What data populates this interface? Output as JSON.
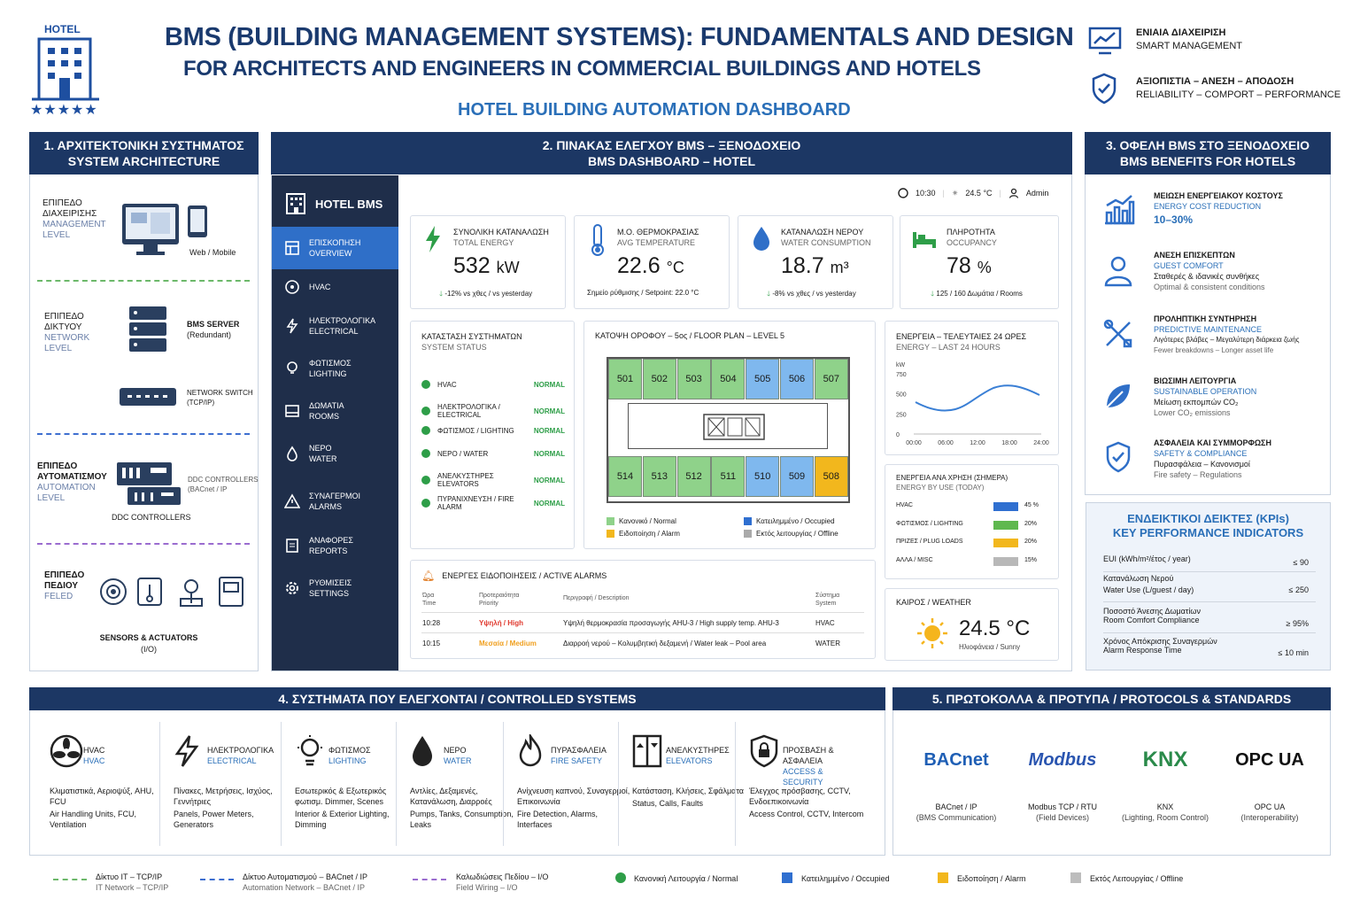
{
  "header": {
    "logo_text": "HOTEL",
    "logo_stars": "★★★★★",
    "title_line1": "BMS (BUILDING MANAGEMENT SYSTEMS): FUNDAMENTALS AND DESIGN",
    "title_line2": "FOR ARCHITECTS AND ENGINEERS IN COMMERCIAL BUILDINGS AND HOTELS",
    "subtitle": "HOTEL BUILDING AUTOMATION DASHBOARD",
    "badge1_gr": "ΕΝΙΑΙΑ ΔΙΑΧΕΙΡΙΣΗ",
    "badge1_en": "SMART MANAGEMENT",
    "badge2_gr": "ΑΞΙΟΠΙΣΤΙΑ – ΑΝΕΣΗ – ΑΠΟΔΟΣΗ",
    "badge2_en": "RELIABILITY – COMPORT – PERFORMANCE"
  },
  "section1": {
    "title_gr": "1. ΑΡΧΙΤΕΚΤΟΝΙΚΗ ΣΥΣΤΗΜΑΤΟΣ",
    "title_en": "SYSTEM ARCHITECTURE",
    "mgmt_gr": "ΕΠΙΠΕΔΟ ΔΙΑΧΕΙΡΙΣΗΣ",
    "mgmt_en": "MANAGEMENT LEVEL",
    "web_mobile": "Web / Mobile",
    "net_gr": "ΕΠΙΠΕΔΟ ΔΙΚΤΥΟΥ",
    "net_en": "NETWORK LEVEL",
    "server": "BMS SERVER",
    "server_sub": "(Redundant)",
    "switch": "NETWORK SWITCH",
    "switch_sub": "(TCP/IP)",
    "auto_gr": "ΕΠΙΠΕΔΟ ΑΥΤΟΜΑΤΙΣΜΟΥ",
    "auto_en": "AUTOMATION LEVEL",
    "ddc": "DDC CONTROLLERS",
    "ddc_sub": "(BACnet / IP",
    "ddc_label": "DDC CONTROLLERS",
    "field_gr": "ΕΠΙΠΕΔΟ ΠΕΔΙΟΥ",
    "field_en": "FELED",
    "sensors": "SENSORS & ACTUATORS",
    "sensors_sub": "(I/O)"
  },
  "section2": {
    "title_gr": "2. ΠΙΝΑΚΑΣ ΕΛΕΓΧΟΥ BMS – ΞΕΝΟΔΟΧΕΙΟ",
    "title_en": "BMS DASHBOARD – HOTEL",
    "app_name": "HOTEL BMS",
    "topbar": {
      "time": "10:30",
      "temp": "24.5 °C",
      "user": "Admin"
    },
    "nav": [
      {
        "gr": "ΕΠΙΣΚΟΠΗΣΗ",
        "en": "OVERVIEW"
      },
      {
        "gr": "HVAC",
        "en": ""
      },
      {
        "gr": "ΗΛΕΚΤΡΟΛΟΓΙΚΑ",
        "en": "ELECTRICAL"
      },
      {
        "gr": "ΦΩΤΙΣΜΟΣ",
        "en": "LIGHTING"
      },
      {
        "gr": "ΔΩΜΑΤΙΑ",
        "en": "ROOMS"
      },
      {
        "gr": "ΝΕΡΟ",
        "en": "WATER"
      },
      {
        "gr": "ΣΥΝΑΓΕΡΜΟΙ",
        "en": "ALARMS"
      },
      {
        "gr": "ΑΝΑΦΟΡΕΣ",
        "en": "REPORTS"
      },
      {
        "gr": "ΡΥΘΜΙΣΕΙΣ",
        "en": "SETTINGS"
      }
    ],
    "kpi_cards": [
      {
        "gr": "ΣΥΝΟΛΙΚΗ ΚΑΤΑΝΑΛΩΣΗ",
        "en": "TOTAL ENERGY",
        "value": "532",
        "unit": "kW",
        "note": "-12% vs χθες / vs yesterday"
      },
      {
        "gr": "Μ.Ο. ΘΕΡΜΟΚΡΑΣΙΑΣ",
        "en": "AVG TEMPERATURE",
        "value": "22.6",
        "unit": "°C",
        "note": "Σημείο ρύθμισης / Setpoint: 22.0 °C"
      },
      {
        "gr": "ΚΑΤΑΝΑΛΩΣΗ ΝΕΡΟΥ",
        "en": "WATER CONSUMPTION",
        "value": "18.7",
        "unit": "m³",
        "note": "-8% vs χθες / vs yesterday"
      },
      {
        "gr": "ΠΛΗΡΟΤΗΤΑ",
        "en": "OCCUPANCY",
        "value": "78",
        "unit": "%",
        "note": "125 / 160 Δωμάτια / Rooms"
      }
    ],
    "status": {
      "title_gr": "ΚΑΤΑΣΤΑΣΗ ΣΥΣΤΗΜΑΤΩΝ",
      "title_en": "SYSTEM STATUS",
      "rows": [
        {
          "name": "HVAC",
          "value": "NORMAL"
        },
        {
          "name": "ΗΛΕΚΤΡΟΛΟΓΙΚΑ / ELECTRICAL",
          "value": "NORMAL"
        },
        {
          "name": "ΦΩΤΙΣΜΟΣ / LIGHTING",
          "value": "NORMAL"
        },
        {
          "name": "ΝΕΡΟ / WATER",
          "value": "NORMAL"
        },
        {
          "name": "ΑΝΕΛΚΥΣΤΗΡΕΣ ELEVATORS",
          "value": "NORMAL"
        },
        {
          "name": "ΠΥΡΑΝΙΧΝΕΥΣΗ / FIRE ALARM",
          "value": "NORMAL"
        }
      ]
    },
    "floorplan": {
      "title": "ΚΑΤΟΨΗ ΟΡΟΦΟΥ – 5ος / FLOOR PLAN – LEVEL 5",
      "top_rooms": [
        {
          "n": "501",
          "s": "normal"
        },
        {
          "n": "502",
          "s": "normal"
        },
        {
          "n": "503",
          "s": "normal"
        },
        {
          "n": "504",
          "s": "normal"
        },
        {
          "n": "505",
          "s": "occupied"
        },
        {
          "n": "506",
          "s": "occupied"
        },
        {
          "n": "507",
          "s": "normal"
        }
      ],
      "bottom_rooms": [
        {
          "n": "514",
          "s": "normal"
        },
        {
          "n": "513",
          "s": "normal"
        },
        {
          "n": "512",
          "s": "normal"
        },
        {
          "n": "511",
          "s": "normal"
        },
        {
          "n": "510",
          "s": "occupied"
        },
        {
          "n": "509",
          "s": "occupied"
        },
        {
          "n": "508",
          "s": "alarm"
        }
      ],
      "legend_normal": "Κανονικό / Normal",
      "legend_alarm": "Ειδοποίηση / Alarm",
      "legend_occupied": "Κατειλημμένο / Occupied",
      "legend_offline": "Εκτός λειτουργίας / Offline"
    },
    "energy24": {
      "title_gr": "ΕΝΕΡΓΕΙΑ – ΤΕΛΕΥΤΑΙΕΣ 24 ΩΡΕΣ",
      "title_en": "ENERGY – LAST 24 HOURS",
      "unit": "kW",
      "yticks": [
        "750",
        "500",
        "250",
        "0"
      ],
      "xticks": [
        "00:00",
        "06:00",
        "12:00",
        "18:00",
        "24:00"
      ]
    },
    "usage": {
      "title_gr": "ΕΝΕΡΓΕΙΑ ΑΝΑ ΧΡΗΣΗ (ΣΗΜΕΡΑ)",
      "title_en": "ENERGY BY USE (TODAY)",
      "rows": [
        {
          "name": "HVAC",
          "pct": "45 %",
          "color": "#2f6fd0"
        },
        {
          "name": "ΦΩΤΙΣΜΟΣ / LIGHTING",
          "pct": "20%",
          "color": "#5fb84f"
        },
        {
          "name": "ΠΡΙΖΕΣ / PLUG LOADS",
          "pct": "20%",
          "color": "#f2b71d"
        },
        {
          "name": "ΑΛΛΑ / MISC",
          "pct": "15%",
          "color": "#b8b8b8"
        }
      ]
    },
    "alarms": {
      "title": "ΕΝΕΡΓΕΣ ΕΙΔΟΠΟΙΗΣΕΙΣ / ACTIVE ALARMS",
      "col_time_gr": "Ώρα",
      "col_time_en": "Time",
      "col_priority_gr": "Προτεραιότητα",
      "col_priority_en": "Priority",
      "col_desc": "Περιγραφή / Description",
      "col_system_gr": "Σύστημα",
      "col_system_en": "System",
      "rows": [
        {
          "time": "10:28",
          "priority": "Υψηλή / High",
          "desc": "Υψηλή θερμοκρασία προσαγωγής AHU-3 / High supply temp. AHU-3",
          "system": "HVAC",
          "color": "#e03a2f"
        },
        {
          "time": "10:15",
          "priority": "Μεσαία / Medium",
          "desc": "Διαρροή νερού – Κολυμβητική δεξαμενή / Water leak – Pool area",
          "system": "WATER",
          "color": "#f0a020"
        }
      ]
    },
    "weather": {
      "title": "ΚΑΙΡΟΣ / WEATHER",
      "temp": "24.5 °C",
      "desc": "Ηλιοφάνεια / Sunny"
    }
  },
  "section3": {
    "title_gr": "3. ΟΦΕΛΗ BMS ΣΤΟ ΞΕΝΟΔΟΧΕΙΟ",
    "title_en": "BMS BENEFITS FOR HOTELS",
    "items": [
      {
        "gr": "ΜΕΙΩΣΗ ΕΝΕΡΓΕΙΑΚΟΥ ΚΟΣΤΟΥΣ",
        "en": "ENERGY COST REDUCTION",
        "d1": "10–30%",
        "d2": ""
      },
      {
        "gr": "ΑΝΕΣΗ ΕΠΙΣΚΕΠΤΩΝ",
        "en": "GUEST COMFORT",
        "d1": "Σταθερές & ιδανικές συνθήκες",
        "d2": "Optimal & consistent conditions"
      },
      {
        "gr": "ΠΡΟΛΗΠΤΙΚΗ ΣΥΝΤΗΡΗΣΗ",
        "en": "PREDICTIVE MAINTENANCE",
        "d1": "Λιγότερες βλάβες – Μεγαλύτερη διάρκεια ζωής",
        "d2": "Fewer breakdowns – Longer asset life"
      },
      {
        "gr": "ΒΙΩΣΙΜΗ ΛΕΙΤΟΥΡΓΙΑ",
        "en": "SUSTAINABLE OPERATION",
        "d1": "Μείωση εκπομπών CO₂",
        "d2": "Lower CO₂ emissions"
      },
      {
        "gr": "ΑΣΦΑΛΕΙΑ ΚΑΙ ΣΥΜΜΟΡΦΩΣΗ",
        "en": "SAFETY & COMPLIANCE",
        "d1": "Πυρασφάλεια – Κανονισμοί",
        "d2": "Fire safety – Regulations"
      }
    ],
    "kpi_title_gr": "ΕΝΔΕΙΚΤΙΚΟΙ ΔΕΙΚΤΕΣ (KPIs)",
    "kpi_title_en": "KEY PERFORMANCE INDICATORS",
    "kpis": [
      {
        "l1": "EUI (kWh/m²/έτος / year)",
        "l2": "",
        "v": "≤ 90"
      },
      {
        "l1": "Κατανάλωση Νερού",
        "l2": "Water Use (L/guest / day)",
        "v": "≤ 250"
      },
      {
        "l1": "Ποσοστό Άνεσης Δωματίων",
        "l2": "Room Comfort Compliance",
        "v": "≥ 95%"
      },
      {
        "l1": "Χρόνος Απόκρισης Συναγερμών",
        "l2": "Alarm Response Time",
        "v": "≤ 10 min"
      }
    ]
  },
  "section4": {
    "title": "4. ΣΥΣΤΗΜΑΤΑ ΠΟΥ ΕΛΕΓΧΟΝΤΑΙ / CONTROLLED SYSTEMS",
    "items": [
      {
        "gr": "HVAC",
        "en": "HVAC",
        "d_gr": "Κλιματιστικά, Αεριοψύξ, AHU, FCU",
        "d_en": "Air Handling Units, FCU, Ventilation"
      },
      {
        "gr": "ΗΛΕΚΤΡΟΛΟΓΙΚΑ",
        "en": "ELECTRICAL",
        "d_gr": "Πίνακες, Μετρήσεις, Ισχύος, Γεννήτριες",
        "d_en": "Panels, Power Meters, Generators"
      },
      {
        "gr": "ΦΩΤΙΣΜΟΣ",
        "en": "LIGHTING",
        "d_gr": "Εσωτερικός & Εξωτερικός φωτισμ. Dimmer, Scenes",
        "d_en": "Interior & Exterior Lighting, Dimming"
      },
      {
        "gr": "ΝΕΡΟ",
        "en": "WATER",
        "d_gr": "Αντλίες, Δεξαμενές, Κατανάλωση, Διαρροές",
        "d_en": "Pumps, Tanks, Consumption, Leaks"
      },
      {
        "gr": "ΠΥΡΑΣΦΑΛΕΙΑ",
        "en": "FIRE SAFETY",
        "d_gr": "Ανίχνευση καπνού, Συναγερμοί, Επικοινωνία",
        "d_en": "Fire Detection, Alarms, Interfaces"
      },
      {
        "gr": "ΑΝΕΛΚΥΣΤΗΡΕΣ",
        "en": "ELEVATORS",
        "d_gr": "Κατάσταση, Κλήσεις, Σφάλματα",
        "d_en": "Status, Calls, Faults"
      },
      {
        "gr": "ΠΡΟΣΒΑΣΗ & ΑΣΦΑΛΕΙΑ",
        "en": "ACCESS & SECURITY",
        "d_gr": "Έλεγχος πρόσβασης, CCTV, Ενδοεπικοινωνία",
        "d_en": "Access Control, CCTV, Intercom"
      }
    ]
  },
  "section5": {
    "title": "5. ΠΡΩΤΟΚΟΛΛΑ & ΠΡΟΤΥΠΑ / PROTOCOLS & STANDARDS",
    "items": [
      {
        "logo": "BACnet",
        "name": "BACnet / IP",
        "sub": "(BMS Communication)",
        "color": "#1f5fb5"
      },
      {
        "logo": "Modbus",
        "name": "Modbus TCP / RTU",
        "sub": "(Field Devices)",
        "color": "#2a55b0"
      },
      {
        "logo": "KNX",
        "name": "KNX",
        "sub": "(Lighting, Room Control)",
        "color": "#2a8a4a"
      },
      {
        "logo": "OPC UA",
        "name": "OPC UA",
        "sub": "(Interoperability)",
        "color": "#111111"
      }
    ]
  },
  "footer": {
    "it_gr": "Δίκτυο IT – TCP/IP",
    "it_en": "IT Network – TCP/IP",
    "auto_gr": "Δίκτυο Αυτοματισμού – BACnet / IP",
    "auto_en": "Automation Network – BACnet / IP",
    "field_gr": "Καλωδιώσεις Πεδίου – I/O",
    "field_en": "Field Wiring – I/O",
    "normal": "Κανονική Λειτουργία / Normal",
    "occupied": "Κατειλημμένο / Occupied",
    "alarm": "Ειδοποίηση / Alarm",
    "offline": "Εκτός Λειτουργίας / Offline"
  },
  "colors": {
    "navy": "#1c3764",
    "normal": "#8fd28a",
    "occupied": "#7fb8ee",
    "alarm": "#f2b71d",
    "offline": "#bdbdbd"
  }
}
